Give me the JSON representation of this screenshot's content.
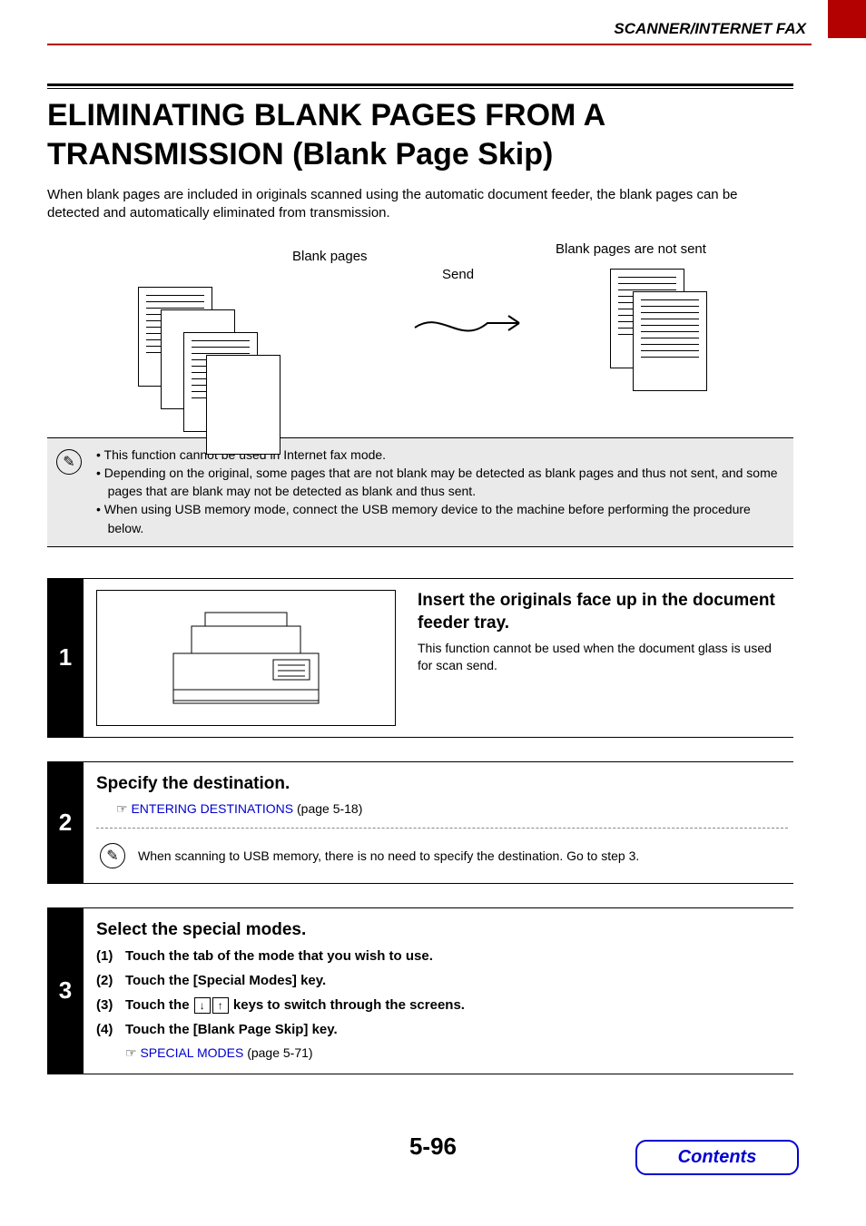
{
  "header": {
    "section": "SCANNER/INTERNET FAX"
  },
  "title": "ELIMINATING BLANK PAGES FROM A TRANSMISSION (Blank Page Skip)",
  "intro": "When blank pages are included in originals scanned using the automatic document feeder, the blank pages can be detected and automatically eliminated from transmission.",
  "diagram": {
    "blank_pages_label": "Blank pages",
    "send_label": "Send",
    "not_sent_label": "Blank pages are not sent"
  },
  "notes": {
    "items": [
      "This function cannot be used in Internet fax mode.",
      "Depending on the original, some pages that are not blank may be detected as blank pages and thus not sent, and some pages that are blank may not be detected as blank and thus sent.",
      "When using USB memory mode, connect the USB memory device to the machine before performing the procedure below."
    ]
  },
  "steps": {
    "s1": {
      "num": "1",
      "title": "Insert the originals face up in the document feeder tray.",
      "desc": "This function cannot be used when the document glass is used for scan send."
    },
    "s2": {
      "num": "2",
      "title": "Specify the destination.",
      "link_text": "ENTERING DESTINATIONS",
      "link_page": " (page 5-18)",
      "note": "When scanning to USB memory, there is no need to specify the destination. Go to step 3."
    },
    "s3": {
      "num": "3",
      "title": "Select the special modes.",
      "items": {
        "i1_num": "(1)",
        "i1_text": "Touch the tab of the mode that you wish to use.",
        "i2_num": "(2)",
        "i2_text": "Touch the [Special Modes] key.",
        "i3_num": "(3)",
        "i3_pre": "Touch the ",
        "i3_post": " keys to switch through the screens.",
        "i4_num": "(4)",
        "i4_text": "Touch the [Blank Page Skip] key."
      },
      "link_text": "SPECIAL MODES",
      "link_page": " (page 5-71)"
    }
  },
  "page_number": "5-96",
  "contents_button": "Contents",
  "icons": {
    "down": "↓",
    "up": "↑"
  }
}
